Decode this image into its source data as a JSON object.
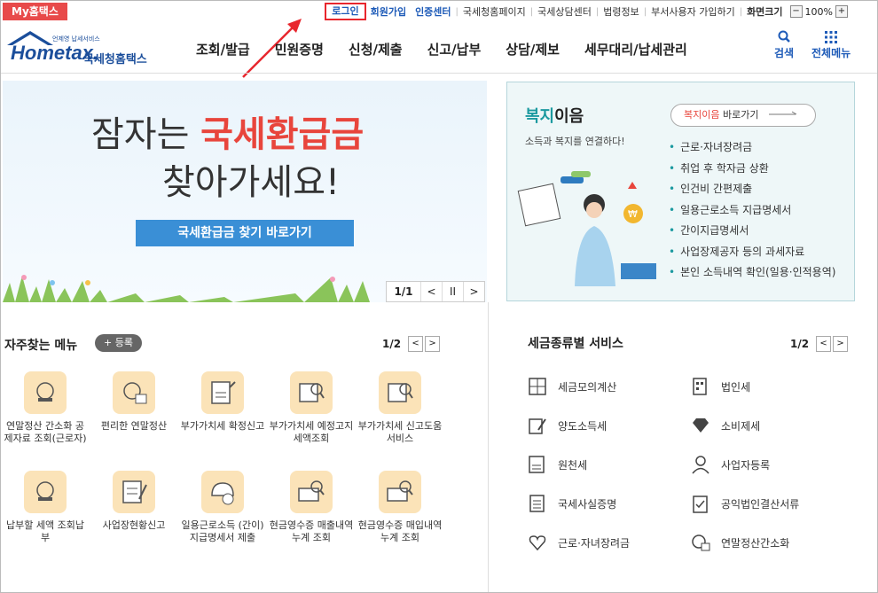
{
  "util": {
    "my_home": "My홈택스",
    "links": [
      "로그인",
      "회원가입",
      "인증센터",
      "국세청홈페이지",
      "국세상담센터",
      "법령정보",
      "부서사용자 가입하기",
      "화면크기"
    ],
    "zoom": "100%",
    "zoom_minus": "−",
    "zoom_plus": "+"
  },
  "header": {
    "logo_main": "Hometax.",
    "logo_sub": "국세청홈택스",
    "logo_tiny": "언제영 납세서비스",
    "nav": [
      "조회/발급",
      "민원증명",
      "신청/제출",
      "신고/납부",
      "상담/제보",
      "세무대리/납세관리"
    ],
    "search_label": "검색",
    "all_menu_label": "전체메뉴"
  },
  "banner": {
    "line1_a": "잠자는 ",
    "line1_b": "국세환급금",
    "line2": "찾아가세요!",
    "button": "국세환급금 찾기 바로가기",
    "page": "1/1",
    "prev": "<",
    "pause": "II",
    "next": ">"
  },
  "welfare": {
    "title_a": "복지",
    "title_b": "이음",
    "subtitle": "소득과 복지를 연결하다!",
    "button_a": "복지이음",
    "button_b": " 바로가기",
    "items": [
      "근로·자녀장려금",
      "취업 후 학자금 상환",
      "인건비 간편제출",
      "일용근로소득 지급명세서",
      "간이지급명세서",
      "사업장제공자 등의 과세자료",
      "본인 소득내역 확인(일용·인적용역)"
    ]
  },
  "frequent": {
    "title": "자주찾는 메뉴",
    "register": "+ 등록",
    "page": "1/2",
    "prev": "<",
    "next": ">",
    "items": [
      "연말정산 간소화 공제자료 조회(근로자)",
      "편리한 연말정산",
      "부가가치세 확정신고",
      "부가가치세 예정고지 세액조회",
      "부가가치세 신고도움 서비스",
      "납부할 세액 조회납부",
      "사업장현황신고",
      "일용근로소득 (간이)지급명세서 제출",
      "현금영수증 매출내역누계 조회",
      "현금영수증 매입내역누계 조회"
    ]
  },
  "taxservice": {
    "title": "세금종류별 서비스",
    "page": "1/2",
    "prev": "<",
    "next": ">",
    "items": [
      "세금모의계산",
      "법인세",
      "양도소득세",
      "소비제세",
      "원천세",
      "사업자등록",
      "국세사실증명",
      "공익법인결산서류",
      "근로·자녀장려금",
      "연말정산간소화"
    ]
  },
  "colors": {
    "accent_blue": "#1e5bb8",
    "red": "#e84a4a",
    "teal": "#1c9aa0"
  }
}
